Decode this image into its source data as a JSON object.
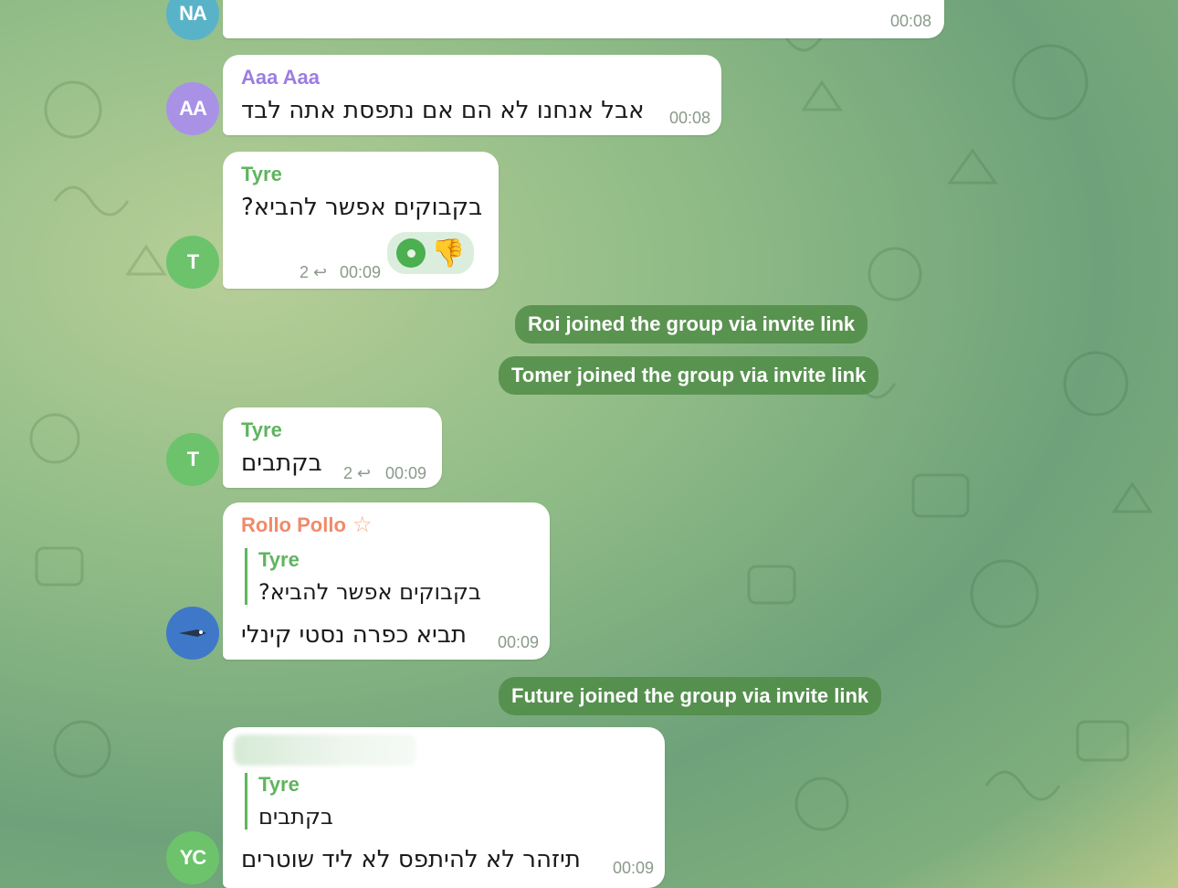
{
  "colors": {
    "bubble": "#ffffff",
    "service_bg": "#508c46",
    "name_tyre": "#5fb45f",
    "name_aaa": "#9b7ee0",
    "name_rollo": "#f08a6a",
    "time": "#8a9a8a"
  },
  "messages": [
    {
      "avatar": "NA",
      "avatar_color": "#59b3c8",
      "time": "00:08"
    },
    {
      "avatar": "AA",
      "avatar_color": "#a992e6",
      "sender": "Aaa Aaa",
      "text": "אבל אנחנו לא הם אם נתפסת אתה לבד",
      "time": "00:08"
    },
    {
      "avatar": "T",
      "avatar_color": "#6cc36c",
      "sender": "Tyre",
      "text": "בקבוקים אפשר להביא?",
      "replies": "2",
      "time": "00:09",
      "reactions": [
        "green-dot-reaction",
        "thumbs-down-emoji"
      ]
    },
    {
      "avatar": "T",
      "avatar_color": "#6cc36c",
      "sender": "Tyre",
      "text": "בקתבים",
      "replies": "2",
      "time": "00:09"
    },
    {
      "avatar": "",
      "avatar_color": "#3f78c9",
      "sender": "Rollo Pollo",
      "sender_icon": "star-icon",
      "quote": {
        "sender": "Tyre",
        "text": "בקבוקים אפשר להביא?"
      },
      "text": "תביא כפרה נסטי קינלי",
      "time": "00:09"
    },
    {
      "avatar": "YC",
      "avatar_color": "#6cc36c",
      "quote": {
        "sender": "Tyre",
        "text": "בקתבים"
      },
      "text": "תיזהר לא להיתפס לא ליד שוטרים",
      "time": "00:09"
    }
  ],
  "service_messages": [
    "Roi joined the group via invite link",
    "Tomer joined the group via invite link",
    "Future joined the group via invite link"
  ]
}
